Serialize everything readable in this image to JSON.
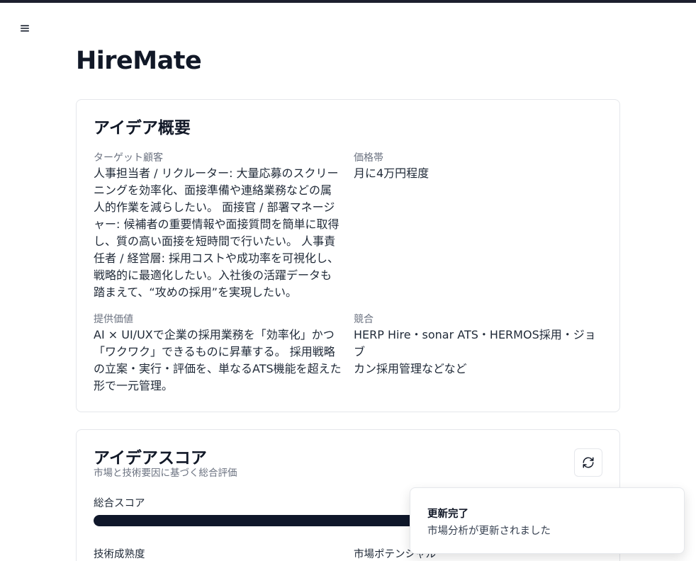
{
  "app": {
    "title": "HireMate"
  },
  "icons": {
    "menu": "hamburger-menu-icon",
    "refresh": "refresh-icon"
  },
  "overview": {
    "title": "アイデア概要",
    "target": {
      "label": "ターゲット顧客",
      "lines": [
        "人事担当者 / リクルーター: 大量応募のスクリー",
        "ニングを効率化、面接準備や連絡業務などの属",
        "人的作業を減らしたい。 面接官 / 部署マネージ",
        "ャー: 候補者の重要情報や面接質問を簡単に取得",
        "し、質の高い面接を短時間で行いたい。 人事責",
        "任者 / 経営層: 採用コストや成功率を可視化し、",
        "戦略的に最適化したい。入社後の活躍データも",
        "踏まえて、“攻めの採用”を実現したい。"
      ]
    },
    "price": {
      "label": "価格帯",
      "lines": [
        "月に4万円程度"
      ]
    },
    "value": {
      "label": "提供価値",
      "lines": [
        "AI × UI/UXで企業の採用業務を「効率化」かつ",
        "「ワクワク」できるものに昇華する。 採用戦略",
        "の立案・実行・評価を、単なるATS機能を超えた",
        "形で一元管理。"
      ]
    },
    "competitors": {
      "label": "競合",
      "lines": [
        "HERP Hire・sonar ATS・HERMOS採用・ジョブ",
        "カン採用管理などなど"
      ]
    }
  },
  "score": {
    "title": "アイデアスコア",
    "subtitle": "市場と技術要因に基づく総合評価",
    "total_label": "総合スコア",
    "total_fraction": 0.68,
    "tech_label": "技術成熟度",
    "market_label": "市場ポテンシャル"
  },
  "toast": {
    "title": "更新完了",
    "description": "市場分析が更新されました"
  }
}
